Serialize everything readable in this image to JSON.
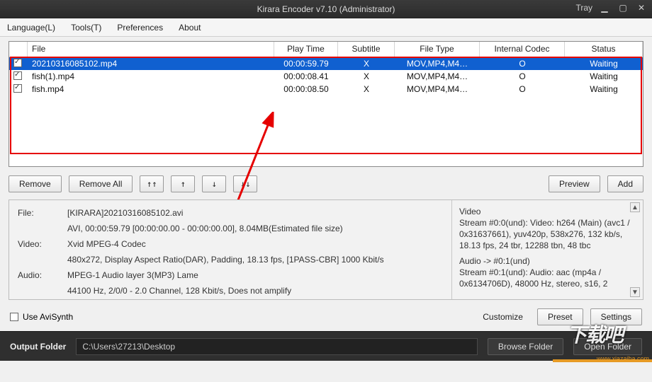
{
  "title": "Kirara Encoder v7.10 (Administrator)",
  "tray": "Tray",
  "menu": {
    "language": "Language(L)",
    "tools": "Tools(T)",
    "preferences": "Preferences",
    "about": "About"
  },
  "columns": {
    "file": "File",
    "playtime": "Play Time",
    "subtitle": "Subtitle",
    "filetype": "File Type",
    "codec": "Internal Codec",
    "status": "Status"
  },
  "rows": [
    {
      "checked": true,
      "file": "20210316085102.mp4",
      "pt": "00:00:59.79",
      "sub": "X",
      "ft": "MOV,MP4,M4…",
      "ic": "O",
      "st": "Waiting",
      "sel": true
    },
    {
      "checked": true,
      "file": "fish(1).mp4",
      "pt": "00:00:08.41",
      "sub": "X",
      "ft": "MOV,MP4,M4…",
      "ic": "O",
      "st": "Waiting",
      "sel": false
    },
    {
      "checked": true,
      "file": "fish.mp4",
      "pt": "00:00:08.50",
      "sub": "X",
      "ft": "MOV,MP4,M4…",
      "ic": "O",
      "st": "Waiting",
      "sel": false
    }
  ],
  "buttons": {
    "remove": "Remove",
    "removeAll": "Remove All",
    "top": "↑↑",
    "up": "↑",
    "down": "↓",
    "bottom": "↓↓",
    "preview": "Preview",
    "add": "Add",
    "customize": "Customize",
    "preset": "Preset",
    "settings": "Settings",
    "browse": "Browse Folder",
    "open": "Open Folder"
  },
  "info": {
    "file_lbl": "File:",
    "file_v1": "[KIRARA]20210316085102.avi",
    "file_v2": "AVI, 00:00:59.79 [00:00:00.00 - 00:00:00.00], 8.04MB(Estimated file size)",
    "video_lbl": "Video:",
    "video_v1": "Xvid MPEG-4 Codec",
    "video_v2": "480x272, Display Aspect Ratio(DAR), Padding, 18.13 fps, [1PASS-CBR] 1000 Kbit/s",
    "audio_lbl": "Audio:",
    "audio_v1": "MPEG-1 Audio layer 3(MP3) Lame",
    "audio_v2": "44100 Hz, 2/0/0 - 2.0 Channel, 128 Kbit/s, Does not amplify"
  },
  "right": {
    "l1": "Video",
    "l2": "Stream #0:0(und): Video: h264 (Main) (avc1 / 0x31637661), yuv420p, 538x276, 132 kb/s, 18.13 fps, 24 tbr, 12288 tbn, 48 tbc",
    "l3": "Audio -> #0:1(und)",
    "l4": "Stream #0:1(und): Audio: aac (mp4a / 0x6134706D), 48000 Hz, stereo, s16, 2"
  },
  "useAvisynth": "Use AviSynth",
  "outFolderLbl": "Output Folder",
  "outFolderPath": "C:\\Users\\27213\\Desktop",
  "watermark": {
    "big": "下载吧",
    "url": "www.xiazaiba.com"
  }
}
